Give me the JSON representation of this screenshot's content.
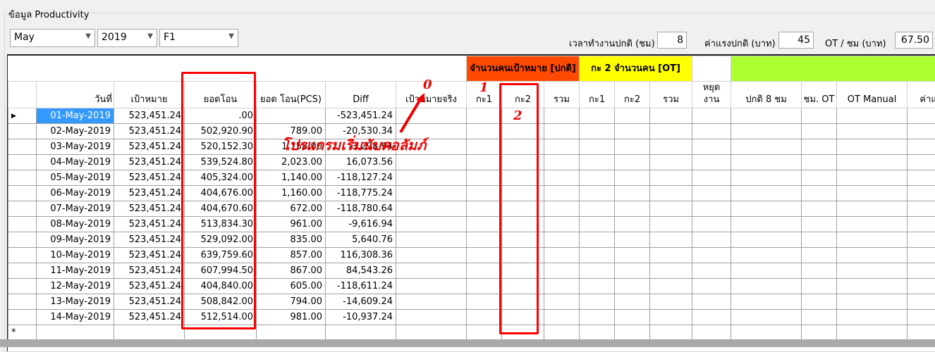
{
  "group_title": "ข้อมูล Productivity",
  "filters": {
    "month": "May",
    "year": "2019",
    "line": "F1"
  },
  "settings": {
    "hours_label": "เวลาทำงานปกติ (ชม)",
    "hours": "8",
    "wage_label": "ค่าแรงปกติ (บาท)",
    "wage": "45",
    "ot_label": "OT / ชม (บาท)",
    "ot": "67.50"
  },
  "group_headers": {
    "normal": "จำนวนคนเป้าหมาย [ปกติ]",
    "ot": "กะ 2 จำนวนคน [OT]",
    "normal_color": "#ff4a00",
    "ot_color": "#ffff00",
    "green_color": "#adff2f"
  },
  "columns": [
    "วันที่",
    "เป้าหมาย",
    "ยอดโอน",
    "ยอด โอน(PCS)",
    "Diff",
    "เป้าหมายจริง",
    "กะ1",
    "กะ2",
    "รวม",
    "กะ1",
    "กะ2",
    "รวม",
    "หยุด งาน",
    "ปกติ 8 ชม",
    "ชม. OT",
    "OT Manual",
    "ค่าแ"
  ],
  "rows": [
    [
      "01-May-2019",
      "523,451.24",
      ".00",
      "",
      "-523,451.24"
    ],
    [
      "02-May-2019",
      "523,451.24",
      "502,920.90",
      "789.00",
      "-20,530.34"
    ],
    [
      "03-May-2019",
      "523,451.24",
      "520,152.30",
      "1,158.00",
      "-3,298.94"
    ],
    [
      "04-May-2019",
      "523,451.24",
      "539,524.80",
      "2,023.00",
      "16,073.56"
    ],
    [
      "05-May-2019",
      "523,451.24",
      "405,324.00",
      "1,140.00",
      "-118,127.24"
    ],
    [
      "06-May-2019",
      "523,451.24",
      "404,676.00",
      "1,160.00",
      "-118,775.24"
    ],
    [
      "07-May-2019",
      "523,451.24",
      "404,670.60",
      "672.00",
      "-118,780.64"
    ],
    [
      "08-May-2019",
      "523,451.24",
      "513,834.30",
      "961.00",
      "-9,616.94"
    ],
    [
      "09-May-2019",
      "523,451.24",
      "529,092.00",
      "835.00",
      "5,640.76"
    ],
    [
      "10-May-2019",
      "523,451.24",
      "639,759.60",
      "857.00",
      "116,308.36"
    ],
    [
      "11-May-2019",
      "523,451.24",
      "607,994.50",
      "867.00",
      "84,543.26"
    ],
    [
      "12-May-2019",
      "523,451.24",
      "404,840.00",
      "605.00",
      "-118,611.24"
    ],
    [
      "13-May-2019",
      "523,451.24",
      "508,842.00",
      "794.00",
      "-14,609.24"
    ],
    [
      "14-May-2019",
      "523,451.24",
      "512,514.00",
      "981.00",
      "-10,937.24"
    ]
  ],
  "new_row_marker": "*",
  "current_row_marker": "▶",
  "annotations": {
    "zero": "0",
    "one": "1",
    "two": "2",
    "note": "โปรแกรมเริ่มนับคอลัมภ์"
  }
}
